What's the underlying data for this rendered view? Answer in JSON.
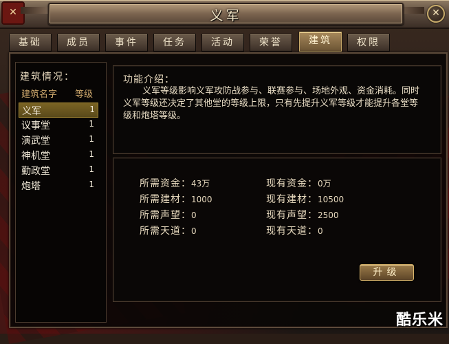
{
  "window": {
    "title": "义军",
    "close_icon": "x"
  },
  "tabs": [
    {
      "label": "基础",
      "active": false
    },
    {
      "label": "成员",
      "active": false
    },
    {
      "label": "事件",
      "active": false
    },
    {
      "label": "任务",
      "active": false
    },
    {
      "label": "活动",
      "active": false
    },
    {
      "label": "荣誉",
      "active": false
    },
    {
      "label": "建筑",
      "active": true
    },
    {
      "label": "权限",
      "active": false
    }
  ],
  "buildings": {
    "heading": "建筑情况：",
    "col_name": "建筑名字",
    "col_level": "等级",
    "items": [
      {
        "name": "义军",
        "level": "1",
        "selected": true
      },
      {
        "name": "议事堂",
        "level": "1",
        "selected": false
      },
      {
        "name": "演武堂",
        "level": "1",
        "selected": false
      },
      {
        "name": "神机堂",
        "level": "1",
        "selected": false
      },
      {
        "name": "勤政堂",
        "level": "1",
        "selected": false
      },
      {
        "name": "炮塔",
        "level": "1",
        "selected": false
      }
    ]
  },
  "info": {
    "heading": "功能介绍：",
    "body": "义军等级影响义军攻防战参与、联赛参与、场地外观、资金消耗。同时义军等级还决定了其他堂的等级上限，只有先提升义军等级才能提升各堂等级和炮塔等级。"
  },
  "requirements": {
    "required": [
      {
        "label": "所需资金：",
        "value": "43万"
      },
      {
        "label": "所需建材：",
        "value": "1000"
      },
      {
        "label": "所需声望：",
        "value": "0"
      },
      {
        "label": "所需天道：",
        "value": "0"
      }
    ],
    "current": [
      {
        "label": "现有资金：",
        "value": "0万"
      },
      {
        "label": "现有建材：",
        "value": "10500"
      },
      {
        "label": "现有声望：",
        "value": "2500"
      },
      {
        "label": "现有天道：",
        "value": "0"
      }
    ]
  },
  "upgrade_button": "升级",
  "watermark": "酷乐米"
}
